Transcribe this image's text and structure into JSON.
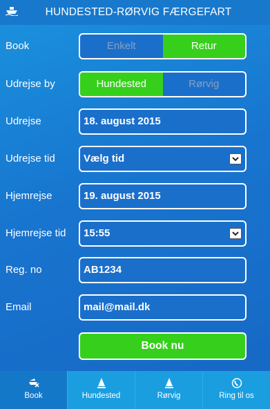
{
  "header": {
    "title": "HUNDESTED-RØRVIG FÆRGEFART",
    "logo_icon": "ferry-icon"
  },
  "form": {
    "book": {
      "label": "Book",
      "options": [
        "Enkelt",
        "Retur"
      ],
      "selected": "Retur"
    },
    "udrejse_by": {
      "label": "Udrejse by",
      "options": [
        "Hundested",
        "Rørvig"
      ],
      "selected": "Hundested"
    },
    "udrejse": {
      "label": "Udrejse",
      "value": "18. august 2015"
    },
    "udrejse_tid": {
      "label": "Udrejse tid",
      "value": "Vælg tid"
    },
    "hjemrejse": {
      "label": "Hjemrejse",
      "value": "19. august 2015"
    },
    "hjemrejse_tid": {
      "label": "Hjemrejse tid",
      "value": "15:55"
    },
    "reg_no": {
      "label": "Reg. no",
      "value": "AB1234"
    },
    "email": {
      "label": "Email",
      "value": "mail@mail.dk"
    },
    "submit_label": "Book nu"
  },
  "tabs": [
    {
      "label": "Book",
      "icon": "ferry-ticket-icon",
      "active": true
    },
    {
      "label": "Hundested",
      "icon": "sailboat-icon",
      "active": false
    },
    {
      "label": "Rørvig",
      "icon": "sailboat-icon",
      "active": false
    },
    {
      "label": "Ring til os",
      "icon": "phone-icon",
      "active": false
    }
  ],
  "colors": {
    "accent_green": "#36d01c",
    "header_blue": "#1878cc",
    "tab_blue": "#1a9ee0"
  }
}
